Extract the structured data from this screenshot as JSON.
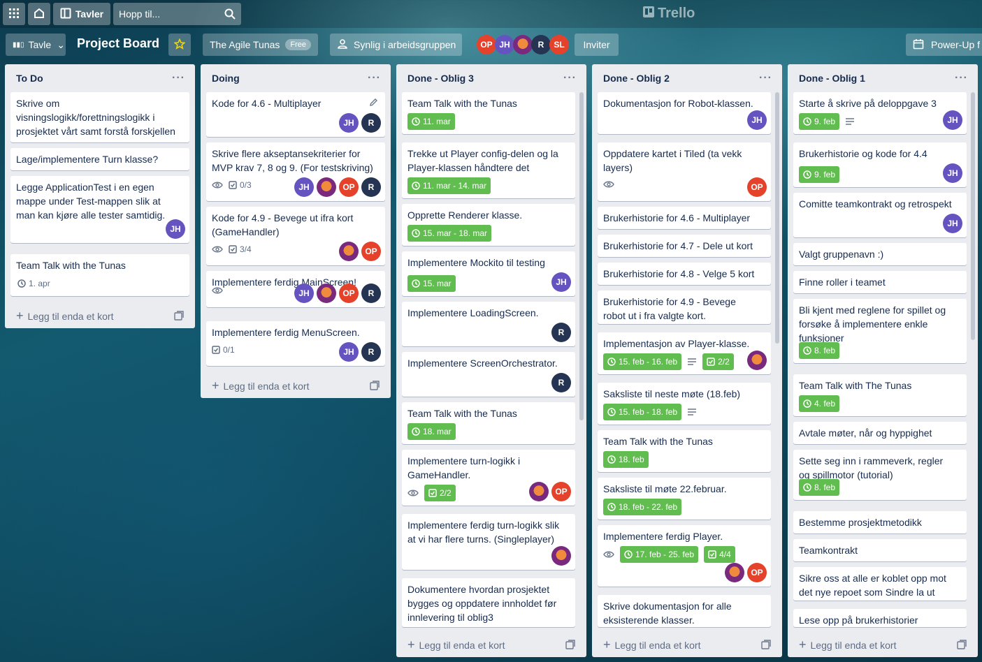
{
  "topnav": {
    "boards_label": "Tavler",
    "search_placeholder": "Hopp til...",
    "logo": "Trello"
  },
  "header": {
    "view_label": "Tavle",
    "board_title": "Project Board",
    "team_name": "The Agile Tunas",
    "team_badge": "Free",
    "visibility_label": "Synlig i arbeidsgruppen",
    "invite_label": "Inviter",
    "powerup_label": "Power-Up f",
    "members": [
      "OP",
      "JH",
      "",
      "R",
      "SL"
    ]
  },
  "add_card_label": "Legg til enda et kort",
  "lists": [
    {
      "title": "To Do",
      "cards": [
        {
          "title": "Skrive om visningslogikk/forettningslogikk i prosjektet vårt samt forstå forskjellen"
        },
        {
          "title": "Lage/implementere Turn klasse?"
        },
        {
          "title": "Legge ApplicationTest i en egen mappe under Test-mappen slik at man kan kjøre alle tester samtidig.",
          "members": [
            "JH"
          ]
        },
        {
          "title": "Team Talk with the Tunas",
          "due": "1. apr"
        }
      ]
    },
    {
      "title": "Doing",
      "cards": [
        {
          "title": "Kode for 4.6 - Multiplayer",
          "members": [
            "JH",
            "R"
          ]
        },
        {
          "title": "Skrive flere akseptansekriterier for MVP krav 7, 8 og 9. (For testskriving)",
          "checklist": "0/3",
          "members": [
            "JH",
            "",
            "OP",
            "R"
          ]
        },
        {
          "title": "Kode for 4.9 - Bevege ut ifra kort (GameHandler)",
          "checklist": "3/4",
          "members": [
            "",
            "OP"
          ]
        },
        {
          "title": "Implementere ferdig MainScreen!",
          "members": [
            "JH",
            "",
            "OP",
            "R"
          ]
        },
        {
          "title": "Implementere ferdig MenuScreen.",
          "checklist": "0/1",
          "members": [
            "JH",
            "R"
          ]
        }
      ]
    },
    {
      "title": "Done - Oblig 3",
      "cards": [
        {
          "title": "Team Talk with the Tunas",
          "due": "11. mar"
        },
        {
          "title": "Trekke ut Player config-delen og la Player-klassen håndtere det",
          "due": "11. mar - 14. mar"
        },
        {
          "title": "Opprette Renderer klasse.",
          "due": "15. mar - 18. mar"
        },
        {
          "title": "Implementere Mockito til testing",
          "due": "15. mar",
          "members": [
            "JH"
          ]
        },
        {
          "title": "Implementere LoadingScreen.",
          "members": [
            "R"
          ]
        },
        {
          "title": "Implementere ScreenOrchestrator.",
          "members": [
            "R"
          ]
        },
        {
          "title": "Team Talk with the Tunas",
          "due": "18. mar"
        },
        {
          "title": "Implementere turn-logikk i GameHandler.",
          "checklist": "2/2",
          "members": [
            "",
            "OP"
          ]
        },
        {
          "title": "Implementere ferdig turn-logikk slik at vi har flere turns. (Singleplayer)",
          "members": [
            ""
          ]
        },
        {
          "title": "Dokumentere hvordan prosjektet bygges og oppdatere innholdet før innlevering til oblig3"
        }
      ]
    },
    {
      "title": "Done - Oblig 2",
      "cards": [
        {
          "title": "Dokumentasjon for Robot-klassen.",
          "members": [
            "JH"
          ]
        },
        {
          "title": "Oppdatere kartet i Tiled (ta vekk layers)",
          "members": [
            "OP"
          ]
        },
        {
          "title": "Brukerhistorie for 4.6 - Multiplayer"
        },
        {
          "title": "Brukerhistorie for 4.7 - Dele ut kort"
        },
        {
          "title": "Brukerhistorie for 4.8 - Velge 5 kort"
        },
        {
          "title": "Brukerhistorie for 4.9 - Bevege robot ut i fra valgte kort."
        },
        {
          "title": "Implementasjon av Player-klasse.",
          "due": "15. feb - 16. feb",
          "checklist": "2/2",
          "members": [
            ""
          ]
        },
        {
          "title": "Saksliste til neste møte (18.feb)",
          "due": "15. feb - 18. feb"
        },
        {
          "title": "Team Talk with the Tunas",
          "due": "18. feb"
        },
        {
          "title": "Saksliste til møte 22.februar.",
          "due": "18. feb - 22. feb"
        },
        {
          "title": "Implementere ferdig Player.",
          "due": "17. feb - 25. feb",
          "checklist": "4/4",
          "members": [
            "",
            "OP"
          ]
        },
        {
          "title": "Skrive dokumentasjon for alle eksisterende klasser."
        }
      ]
    },
    {
      "title": "Done - Oblig 1",
      "cards": [
        {
          "title": "Starte å skrive på deloppgave 3",
          "due": "9. feb",
          "members": [
            "JH"
          ]
        },
        {
          "title": "Brukerhistorie og kode for 4.4",
          "due": "9. feb",
          "members": [
            "JH"
          ]
        },
        {
          "title": "Comitte teamkontrakt og retrospekt",
          "members": [
            "JH"
          ]
        },
        {
          "title": "Valgt gruppenavn :)"
        },
        {
          "title": "Finne roller i teamet"
        },
        {
          "title": "Bli kjent med reglene for spillet og forsøke å implementere enkle funksjoner",
          "due": "8. feb"
        },
        {
          "title": "Team Talk with The Tunas",
          "due": "4. feb"
        },
        {
          "title": "Avtale møter, når og hyppighet"
        },
        {
          "title": "Sette seg inn i rammeverk, regler og spillmotor (tutorial)",
          "due": "8. feb"
        },
        {
          "title": "Bestemme prosjektmetodikk"
        },
        {
          "title": "Teamkontrakt"
        },
        {
          "title": "Sikre oss at alle er koblet opp mot det nye repoet som Sindre la ut"
        },
        {
          "title": "Lese opp på brukerhistorier"
        }
      ]
    }
  ],
  "colors": {
    "due_green": "#61bd4f",
    "list_bg": "#ebecf0",
    "avatar_jh": "#6554c0",
    "avatar_r": "#243452",
    "avatar_op": "#e5422b"
  }
}
